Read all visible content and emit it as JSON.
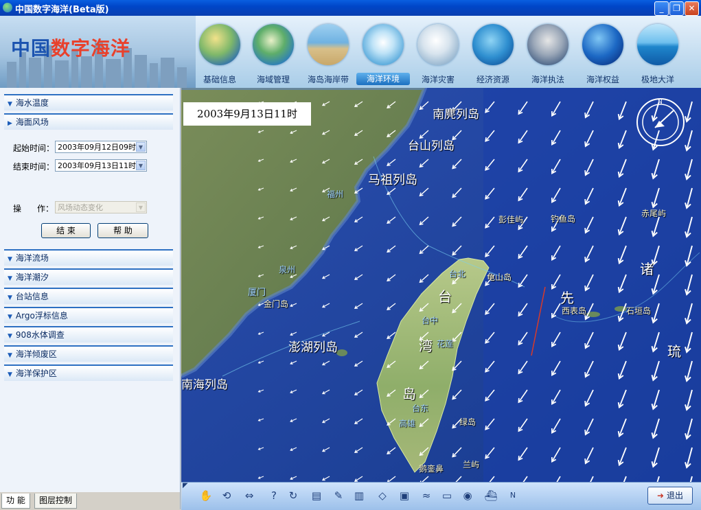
{
  "window": {
    "title": "中国数字海洋(Beta版)"
  },
  "header": {
    "logo_part1": "中国",
    "logo_part2": "数字海洋",
    "nav": [
      {
        "label": "基础信息",
        "icon": "globe-asia-icon"
      },
      {
        "label": "海域管理",
        "icon": "island-icon"
      },
      {
        "label": "海岛海岸带",
        "icon": "beach-icon"
      },
      {
        "label": "海洋环境",
        "icon": "seagull-icon"
      },
      {
        "label": "海洋灾害",
        "icon": "storm-icon"
      },
      {
        "label": "经济资源",
        "icon": "dolphin-icon"
      },
      {
        "label": "海洋执法",
        "icon": "officer-icon"
      },
      {
        "label": "海洋权益",
        "icon": "sea-globe-icon"
      },
      {
        "label": "极地大洋",
        "icon": "ocean-icon"
      }
    ],
    "active_nav": "海洋环境"
  },
  "left_panel": {
    "sections_top": [
      "海水温度",
      "海面风场"
    ],
    "form": {
      "start_label": "起始时间：",
      "start_value": "2003年09月12日09时",
      "end_label": "结束时间：",
      "end_value": "2003年09月13日11时",
      "op_label_1": "操",
      "op_label_2": "作：",
      "op_value": "风场动态变化",
      "end_button": "结 束",
      "help_button": "帮 助"
    },
    "sections_bottom": [
      "海洋流场",
      "海洋潮汐",
      "台站信息",
      "Argo浮标信息",
      "908水体调查",
      "海洋倾废区",
      "海洋保护区"
    ],
    "tabs": [
      "功 能",
      "图层控制"
    ]
  },
  "map": {
    "timestamp": "2003年9月13日11时",
    "places": [
      {
        "name": "南麂列岛",
        "size": "big"
      },
      {
        "name": "台山列岛",
        "size": "big"
      },
      {
        "name": "马祖列岛",
        "size": "big"
      },
      {
        "name": "福州",
        "size": "city"
      },
      {
        "name": "泉州",
        "size": "city"
      },
      {
        "name": "厦门",
        "size": "city"
      },
      {
        "name": "金门岛",
        "size": "small"
      },
      {
        "name": "澎湖列岛",
        "size": "big"
      },
      {
        "name": "南海列岛",
        "size": "big"
      },
      {
        "name": "台北",
        "size": "city"
      },
      {
        "name": "台中",
        "size": "city"
      },
      {
        "name": "花莲",
        "size": "city"
      },
      {
        "name": "台东",
        "size": "city"
      },
      {
        "name": "高雄",
        "size": "city"
      },
      {
        "name": "龟山岛",
        "size": "small"
      },
      {
        "name": "钓鱼岛",
        "size": "small"
      },
      {
        "name": "赤尾屿",
        "size": "small"
      },
      {
        "name": "彭佳屿",
        "size": "small"
      },
      {
        "name": "西表岛",
        "size": "small"
      },
      {
        "name": "石垣岛",
        "size": "small"
      },
      {
        "name": "绿岛",
        "size": "small"
      },
      {
        "name": "兰屿",
        "size": "small"
      },
      {
        "name": "鹅銮鼻",
        "size": "small"
      },
      {
        "name": "台",
        "size": "big"
      },
      {
        "name": "湾",
        "size": "big"
      },
      {
        "name": "岛",
        "size": "big"
      },
      {
        "name": "先",
        "size": "big"
      },
      {
        "name": "诸",
        "size": "big"
      },
      {
        "name": "琉",
        "size": "big"
      }
    ],
    "compass_label": "N"
  },
  "toolbar": {
    "tools": [
      "pan-icon",
      "rotate-icon",
      "full-extent-icon",
      "identify-icon",
      "measure-icon",
      "layer-icon",
      "draw-icon",
      "building-icon",
      "locate-icon",
      "camera-icon",
      "wave-icon",
      "ruler-icon",
      "view-icon",
      "ship-icon",
      "north-icon"
    ],
    "exit_label": "退出"
  }
}
